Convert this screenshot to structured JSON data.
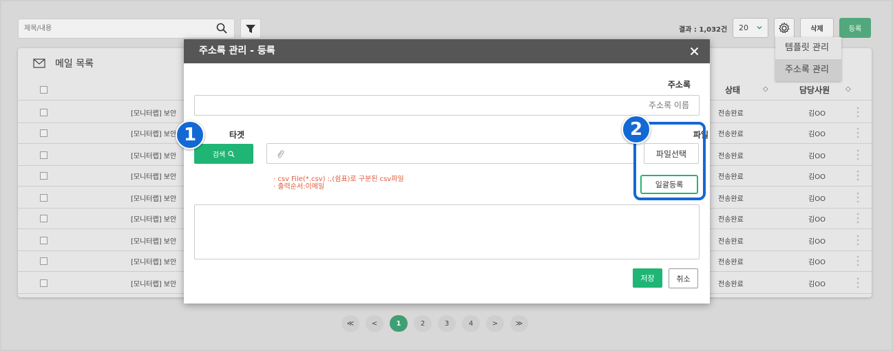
{
  "search": {
    "placeholder": "제목/내용"
  },
  "toolbar": {
    "result": "결과 : 1,032건",
    "page_size": "20",
    "delete_label": "삭제",
    "register_label": "등록"
  },
  "dropdown": {
    "items": [
      "템플릿 관리",
      "주소록 관리"
    ]
  },
  "list": {
    "title": "메일 목록",
    "col_status": "상태",
    "col_staff": "담당사원",
    "rows": [
      {
        "title": "[모니터랩] 보안",
        "status": "전송완료",
        "staff": "김OO"
      },
      {
        "title": "[모니터랩] 보안",
        "status": "전송완료",
        "staff": "김OO"
      },
      {
        "title": "[모니터랩] 보안",
        "status": "전송완료",
        "staff": "김OO"
      },
      {
        "title": "[모니터랩] 보안",
        "status": "전송완료",
        "staff": "김OO"
      },
      {
        "title": "[모니터랩] 보안",
        "status": "전송완료",
        "staff": "김OO"
      },
      {
        "title": "[모니터랩] 보안",
        "status": "전송완료",
        "staff": "김OO"
      },
      {
        "title": "[모니터랩] 보안",
        "status": "전송완료",
        "staff": "김OO"
      },
      {
        "title": "[모니터랩] 보안",
        "status": "전송완료",
        "staff": "김OO"
      },
      {
        "title": "[모니터랩] 보안",
        "status": "전송완료",
        "staff": "김OO"
      }
    ]
  },
  "pagination": {
    "first": "≪",
    "prev": "<",
    "pages": [
      "1",
      "2",
      "3",
      "4"
    ],
    "current": "1",
    "next": ">",
    "last": "≫"
  },
  "modal": {
    "title": "주소록 관리 - 등록",
    "address_label": "주소록",
    "address_placeholder": "주소록 이름",
    "target_label": "타겟",
    "search_label": "검색",
    "file_label": "파일",
    "file_select_label": "파일선택",
    "bulk_register_label": "일괄등록",
    "hint_line1": "· csv File(*.csv) :,(쉼표)로 구분된 csv파일",
    "hint_line2": "· 출력순서:이메일",
    "save_label": "저장",
    "cancel_label": "취소"
  },
  "callouts": [
    "1",
    "2"
  ],
  "colors": {
    "accent_green": "#1fb574",
    "callout_blue": "#1369d4",
    "modal_header": "#565656"
  }
}
